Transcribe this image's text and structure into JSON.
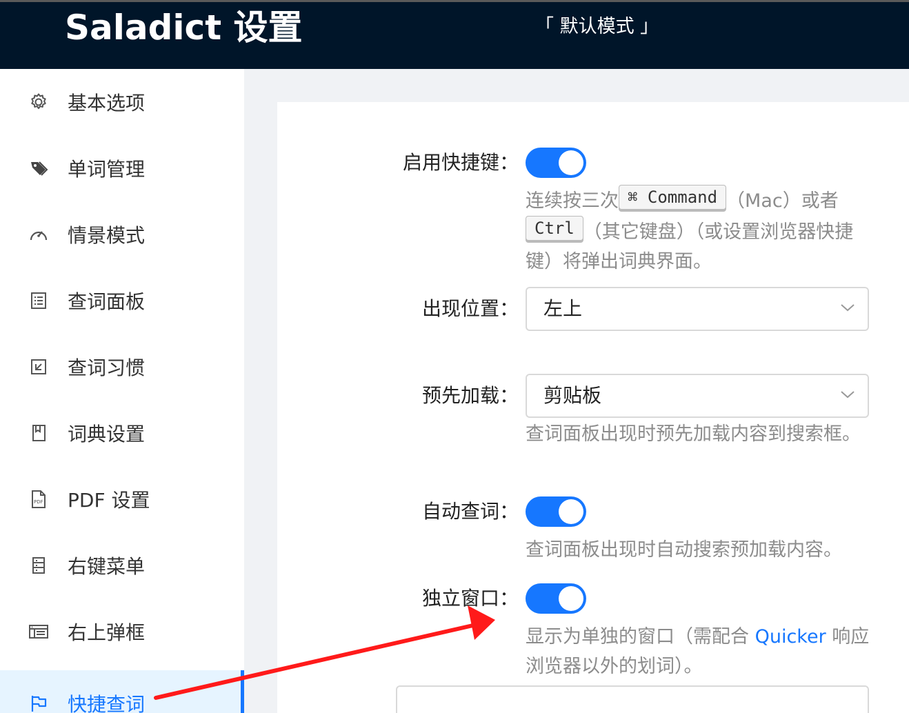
{
  "header": {
    "title": "Saladict 设置",
    "mode": "「 默认模式 」"
  },
  "sidebar": {
    "items": [
      {
        "label": "基本选项",
        "icon": "gear-icon"
      },
      {
        "label": "单词管理",
        "icon": "tag-icon"
      },
      {
        "label": "情景模式",
        "icon": "dashboard-icon"
      },
      {
        "label": "查词面板",
        "icon": "list-icon"
      },
      {
        "label": "查词习惯",
        "icon": "select-icon"
      },
      {
        "label": "词典设置",
        "icon": "book-icon"
      },
      {
        "label": "PDF 设置",
        "icon": "pdf-file-icon"
      },
      {
        "label": "右键菜单",
        "icon": "menu-panel-icon"
      },
      {
        "label": "右上弹框",
        "icon": "popup-window-icon"
      },
      {
        "label": "快捷查词",
        "icon": "flag-icon",
        "active": true
      }
    ]
  },
  "form": {
    "hotkey": {
      "label": "启用快捷键：",
      "enabled": true,
      "help_prefix": "连续按三次",
      "key_command": "⌘ Command",
      "help_mac": "（Mac）或者",
      "key_ctrl": "Ctrl",
      "help_suffix": "（其它键盘）（或设置浏览器快捷键）将弹出词典界面。"
    },
    "position": {
      "label": "出现位置：",
      "value": "左上"
    },
    "preload": {
      "label": "预先加载：",
      "value": "剪贴板",
      "help": "查词面板出现时预先加载内容到搜索框。"
    },
    "auto_search": {
      "label": "自动查词：",
      "enabled": true,
      "help": "查词面板出现时自动搜索预加载内容。"
    },
    "standalone": {
      "label": "独立窗口：",
      "enabled": true,
      "help_prefix": "显示为单独的窗口（需配合 ",
      "link": "Quicker",
      "help_suffix": " 响应浏览器以外的划词）。"
    }
  },
  "colors": {
    "header_bg": "#001529",
    "accent": "#1677ff",
    "annotation_arrow": "#ff1a1a"
  }
}
